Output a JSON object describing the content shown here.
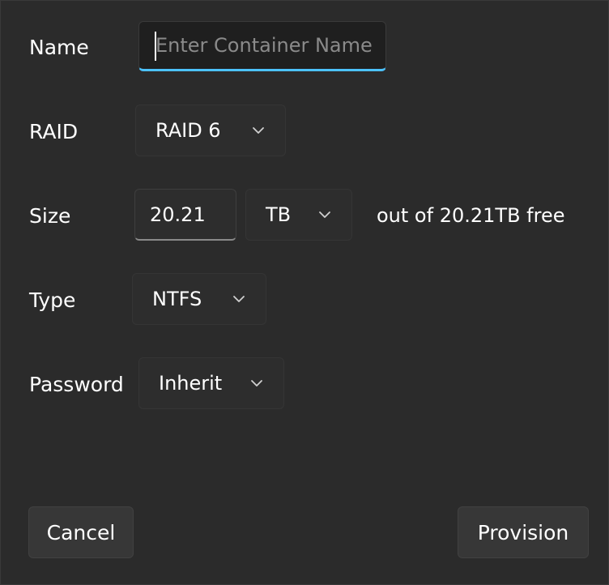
{
  "form": {
    "name": {
      "label": "Name",
      "value": "",
      "placeholder": "Enter Container Name"
    },
    "raid": {
      "label": "RAID",
      "selected": "RAID 6"
    },
    "size": {
      "label": "Size",
      "value": "20.21",
      "unit": "TB",
      "free_text": "out of 20.21TB free"
    },
    "type": {
      "label": "Type",
      "selected": "NTFS"
    },
    "password": {
      "label": "Password",
      "selected": "Inherit"
    }
  },
  "buttons": {
    "cancel": "Cancel",
    "provision": "Provision"
  },
  "icons": {
    "dropdown": "chevron-down-icon"
  },
  "colors": {
    "accent": "#4cc2ff",
    "background": "#2b2b2b",
    "control": "#2d2d2d"
  }
}
